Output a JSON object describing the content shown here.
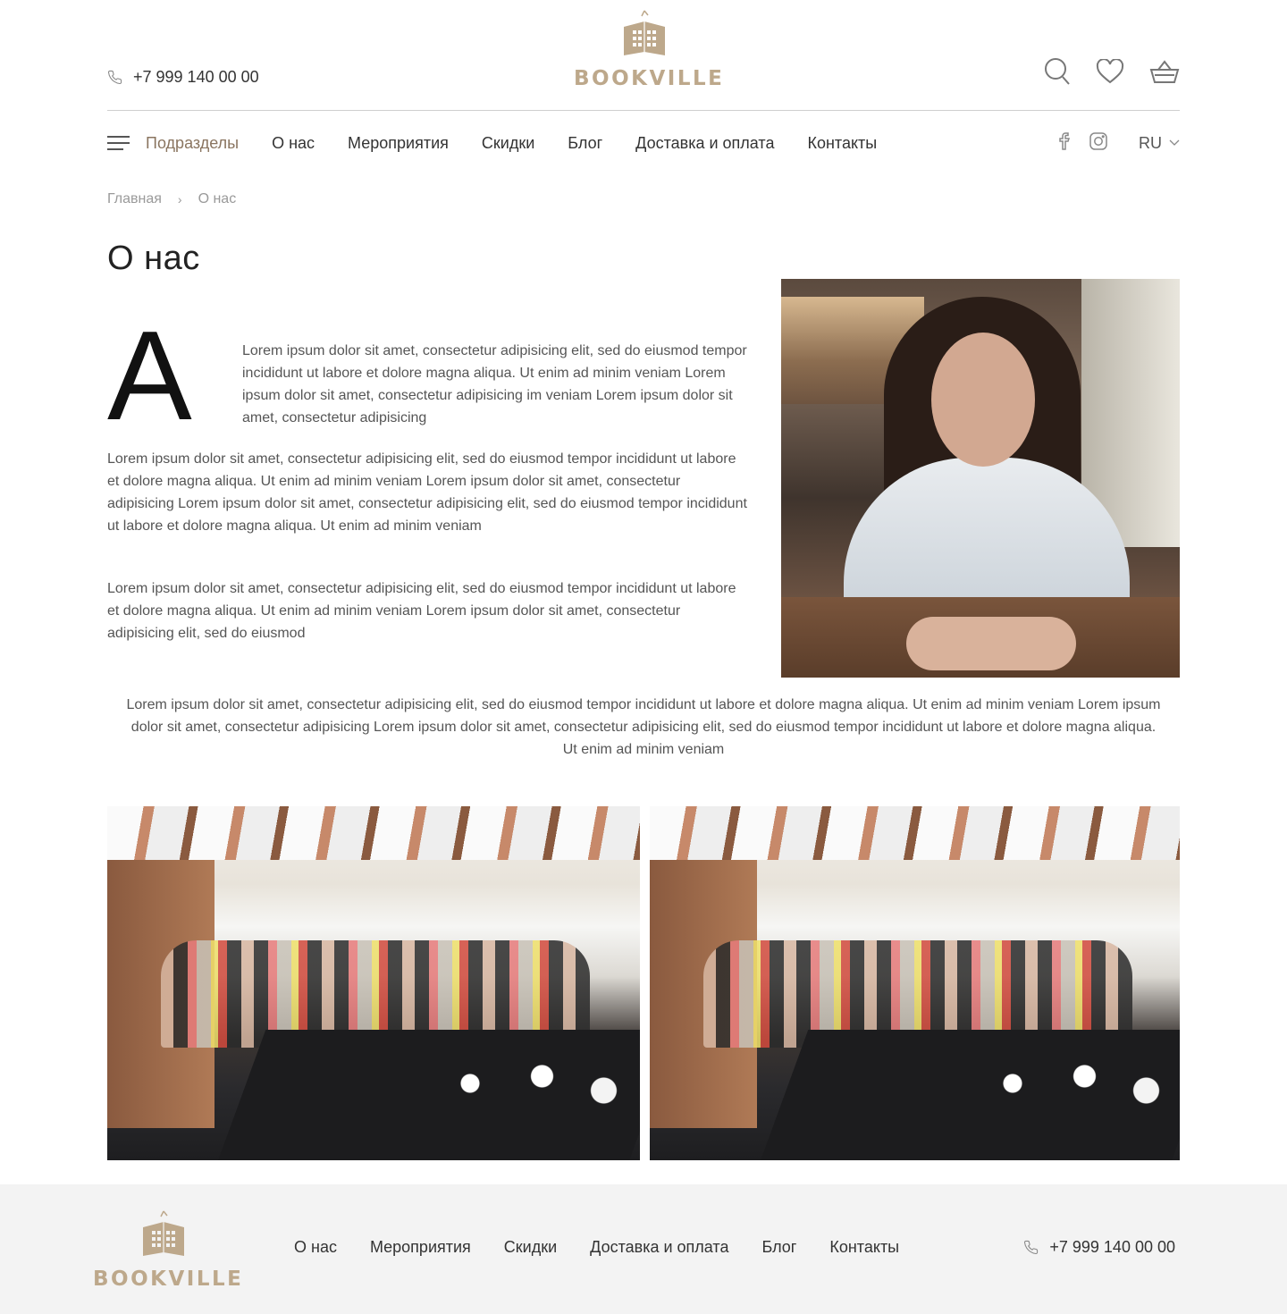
{
  "header": {
    "phone": "+7 999 140 00 00",
    "logo_text": "BOOKVILLE"
  },
  "nav": {
    "menu_label": "Подразделы",
    "items": [
      "О нас",
      "Мероприятия",
      "Скидки",
      "Блог",
      "Доставка и оплата",
      "Контакты"
    ],
    "lang": "RU"
  },
  "breadcrumb": {
    "home": "Главная",
    "current": "О нас"
  },
  "page": {
    "title": "О нас",
    "dropcap": "A",
    "intro": "Lorem ipsum dolor sit amet, consectetur adipisicing elit, sed do eiusmod tempor incididunt ut labore et dolore magna aliqua. Ut enim ad minim veniam Lorem ipsum dolor sit amet, consectetur adipisicing im veniam Lorem ipsum dolor sit amet, consectetur adipisicing",
    "paragraph_1": "Lorem ipsum dolor sit amet, consectetur adipisicing elit, sed do eiusmod tempor incididunt ut labore et dolore magna aliqua. Ut enim ad minim veniam Lorem ipsum dolor sit amet, consectetur adipisicing Lorem ipsum dolor sit amet, consectetur adipisicing elit, sed do eiusmod tempor incididunt ut labore et dolore magna aliqua. Ut enim ad minim veniam",
    "paragraph_2": "Lorem ipsum dolor sit amet, consectetur adipisicing elit, sed do eiusmod tempor incididunt ut labore et dolore magna aliqua. Ut enim ad minim veniam Lorem ipsum dolor sit amet, consectetur adipisicing elit, sed do eiusmod",
    "center_paragraph": "Lorem ipsum dolor sit amet, consectetur adipisicing elit, sed do eiusmod tempor incididunt ut labore et dolore magna aliqua. Ut enim ad minim veniam Lorem ipsum dolor sit amet, consectetur adipisicing Lorem ipsum dolor sit amet, consectetur adipisicing elit, sed do eiusmod tempor incididunt ut labore et dolore magna aliqua. Ut enim ad minim veniam"
  },
  "footer": {
    "logo_text": "BOOKVILLE",
    "nav": [
      "О нас",
      "Мероприятия",
      "Скидки",
      "Доставка и оплата",
      "Блог",
      "Контакты"
    ],
    "phone": "+7 999 140 00 00"
  },
  "colors": {
    "brand": "#bda88b",
    "accent_nav": "#8a7560",
    "footer_bg": "#f3f3f3",
    "text": "#333333",
    "muted": "#9a9a9a"
  },
  "icons": {
    "phone": "phone-icon",
    "search": "search-icon",
    "favorites": "heart-icon",
    "cart": "basket-icon",
    "menu": "hamburger-icon",
    "facebook": "facebook-icon",
    "instagram": "instagram-icon",
    "lang_dropdown": "chevron-down-icon"
  }
}
